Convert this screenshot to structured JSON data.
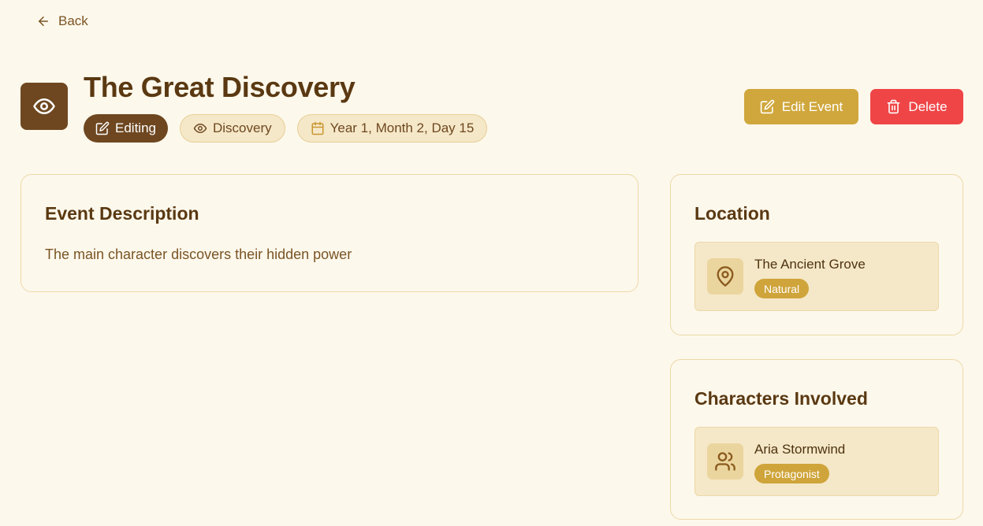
{
  "nav": {
    "back_label": "Back"
  },
  "event": {
    "title": "The Great Discovery",
    "tags": {
      "editing": "Editing",
      "type": "Discovery",
      "date": "Year 1, Month 2, Day 15"
    }
  },
  "actions": {
    "edit_label": "Edit Event",
    "delete_label": "Delete"
  },
  "description": {
    "heading": "Event Description",
    "text": "The main character discovers their hidden power"
  },
  "location": {
    "heading": "Location",
    "name": "The Ancient Grove",
    "badge": "Natural"
  },
  "characters": {
    "heading": "Characters Involved",
    "items": [
      {
        "name": "Aria Stormwind",
        "role": "Protagonist"
      }
    ]
  },
  "colors": {
    "background": "#fdf8ec",
    "primary_brown": "#6e4720",
    "gold": "#d0a73c",
    "danger": "#ef4547"
  }
}
